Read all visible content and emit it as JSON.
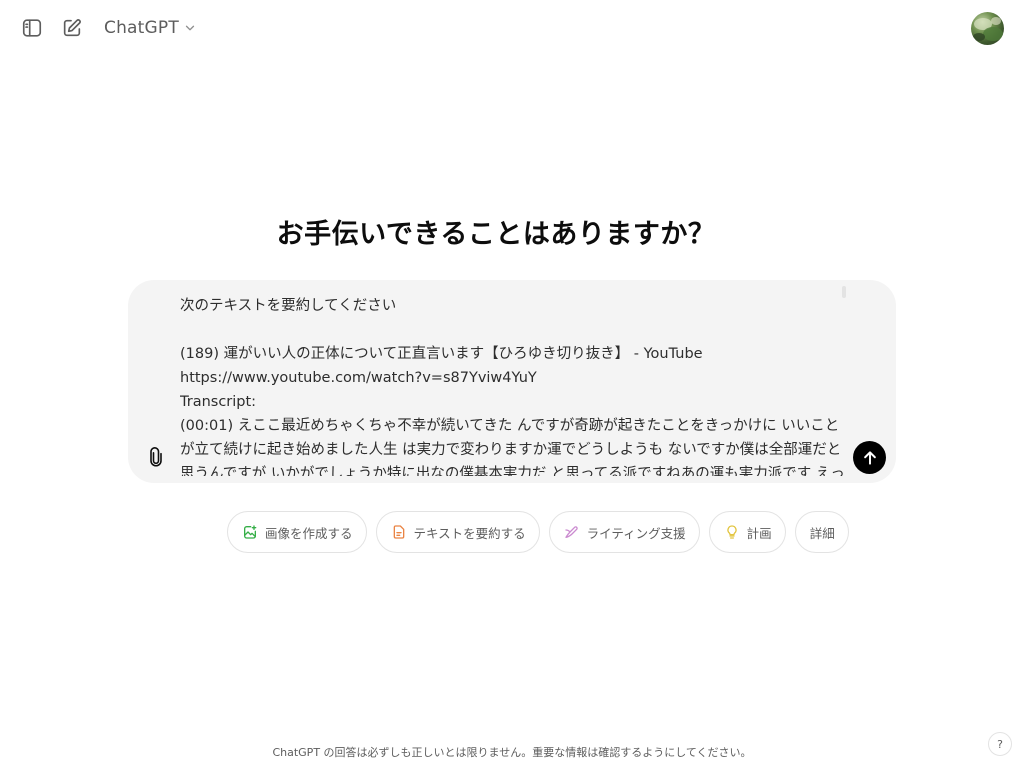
{
  "header": {
    "model_label": "ChatGPT",
    "sidebar_icon": "sidebar-toggle-icon",
    "new_chat_icon": "new-chat-icon",
    "model_chevron_icon": "chevron-down-icon",
    "avatar_icon": "user-avatar"
  },
  "main": {
    "heading": "お手伝いできることはありますか？"
  },
  "composer": {
    "lines": [
      "次のテキストを要約してください",
      "",
      "(189) 運がいい人の正体について正直言います【ひろゆき切り抜き】 - YouTube",
      "https://www.youtube.com/watch?v=s87Yviw4YuY",
      "Transcript:",
      "(00:01) えここ最近めちゃくちゃ不幸が続いてきた んですが奇跡が起きたことをきっかけに いいことが立て続けに起き始めました人生 は実力で変わりますか運でどうしようも ないですか僕は全部運だと思うんですが いかがでしょうか特に出なの僕基本実力だ と思ってる派ですねあの運も実力派です えっとたまたま良いことが起き"
    ],
    "attach_icon": "paperclip-icon",
    "send_icon": "arrow-up-icon",
    "send_bg": "#000000",
    "bg": "#f4f4f4"
  },
  "suggestions": [
    {
      "label": "画像を作成する",
      "icon": "image-create-icon",
      "color": "#35ae47"
    },
    {
      "label": "テキストを要約する",
      "icon": "document-icon",
      "color": "#ea8444"
    },
    {
      "label": "ライティング支援",
      "icon": "pen-icon",
      "color": "#cb8bd0"
    },
    {
      "label": "計画",
      "icon": "lightbulb-icon",
      "color": "#e2c541"
    },
    {
      "label": "詳細",
      "icon": "",
      "color": ""
    }
  ],
  "footer": {
    "disclaimer": "ChatGPT の回答は必ずしも正しいとは限りません。重要な情報は確認するようにしてください。",
    "help_label": "?"
  }
}
